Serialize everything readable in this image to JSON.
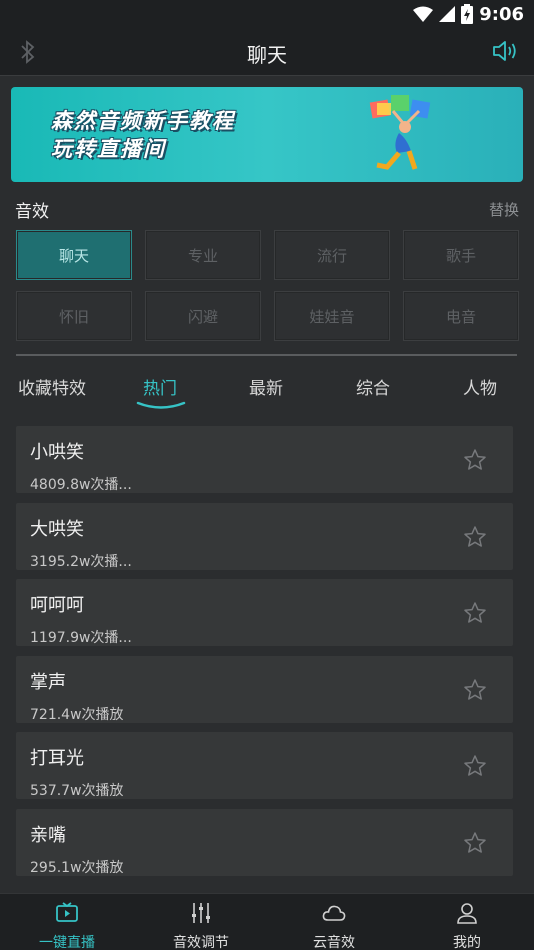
{
  "status": {
    "time": "9:06"
  },
  "header": {
    "title": "聊天"
  },
  "banner": {
    "line1": "森然音频新手教程",
    "line2": "玩转直播间"
  },
  "effects": {
    "title": "音效",
    "action": "替换",
    "presets": [
      {
        "label": "聊天",
        "active": true
      },
      {
        "label": "专业"
      },
      {
        "label": "流行"
      },
      {
        "label": "歌手"
      },
      {
        "label": "怀旧"
      },
      {
        "label": "闪避"
      },
      {
        "label": "娃娃音"
      },
      {
        "label": "电音"
      }
    ]
  },
  "tabs": [
    {
      "label": "收藏特效"
    },
    {
      "label": "热门",
      "active": true
    },
    {
      "label": "最新"
    },
    {
      "label": "综合"
    },
    {
      "label": "人物"
    }
  ],
  "list": [
    {
      "name": "小哄笑",
      "count": "4809.8w次播..."
    },
    {
      "name": "大哄笑",
      "count": "3195.2w次播..."
    },
    {
      "name": "呵呵呵",
      "count": "1197.9w次播..."
    },
    {
      "name": "掌声",
      "count": "721.4w次播放"
    },
    {
      "name": "打耳光",
      "count": "537.7w次播放"
    },
    {
      "name": "亲嘴",
      "count": "295.1w次播放"
    }
  ],
  "nav": [
    {
      "label": "一键直播",
      "icon": "tv-icon",
      "active": true
    },
    {
      "label": "音效调节",
      "icon": "sliders-icon"
    },
    {
      "label": "云音效",
      "icon": "cloud-icon"
    },
    {
      "label": "我的",
      "icon": "person-icon"
    }
  ],
  "colors": {
    "accent": "#36c3c6",
    "background": "#2b2d2f",
    "active_preset": "#1f6f71"
  }
}
